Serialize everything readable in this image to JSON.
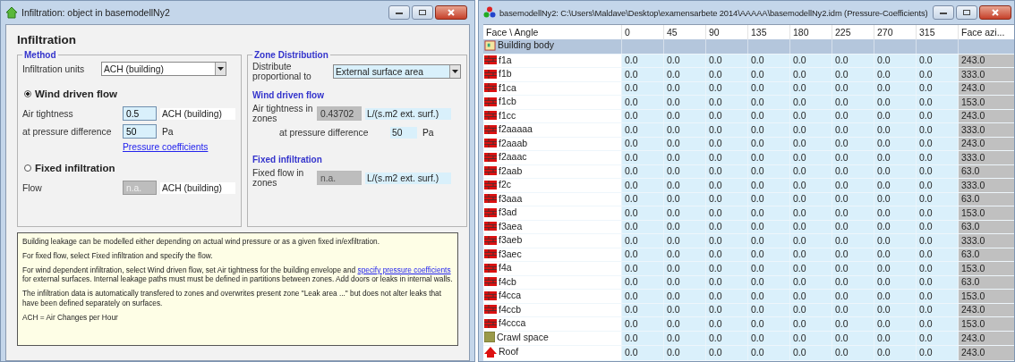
{
  "infiltration_window": {
    "title": "Infiltration: object in basemodellNy2",
    "heading": "Infiltration",
    "method": {
      "legend": "Method",
      "units_label": "Infiltration units",
      "units_value": "ACH (building)",
      "options": [
        {
          "label": "Wind driven flow",
          "selected": true
        },
        {
          "label": "Fixed infiltration",
          "selected": false
        }
      ],
      "air_tightness_label": "Air tightness",
      "air_tightness_value": "0.5",
      "air_tightness_unit": "ACH (building)",
      "pressure_label": "at pressure difference",
      "pressure_value": "50",
      "pressure_unit": "Pa",
      "pressure_link": "Pressure coefficients",
      "flow_label": "Flow",
      "flow_value": "n.a.",
      "flow_disabled": true,
      "flow_unit": "ACH (building)"
    },
    "zone_distribution": {
      "legend": "Zone Distribution",
      "distribute_label": "Distribute proportional to",
      "distribute_value": "External surface area",
      "wind_heading": "Wind driven flow",
      "zone_tightness_label": "Air tightness in zones",
      "zone_tightness_value": "0.43702",
      "zone_tightness_unit": "L/(s.m2 ext. surf.)",
      "zone_pressure_label": "at pressure difference",
      "zone_pressure_value": "50",
      "zone_pressure_unit": "Pa",
      "fixed_heading": "Fixed infiltration",
      "fixed_flow_label": "Fixed flow in zones",
      "fixed_flow_value": "n.a.",
      "fixed_flow_disabled": true,
      "fixed_flow_unit": "L/(s.m2 ext. surf.)"
    },
    "help": {
      "p1": "Building leakage can be modelled either depending on actual wind pressure or as a given fixed in/exfiltration.",
      "p2": "For fixed flow,  select Fixed infiltration and specify the flow.",
      "p3_before": "For wind dependent infiltration,  select Wind driven flow, set Air tightness for the building envelope and",
      "p3_link": "specify pressure coefficients",
      "p3_after": "for external surfaces. Internal leakage paths must must be defined in partitions between zones. Add doors or leaks in internal walls.",
      "p4": "The infiltration data is automatically  transfered  to zones and overwrites present zone \"Leak area ...\" but does not alter leaks that have been defined separately on surfaces.",
      "p5": "ACH = Air Changes per Hour"
    }
  },
  "coefficients_window": {
    "title": "basemodellNy2: C:\\Users\\Maldave\\Desktop\\examensarbete 2014\\AAAAA\\basemodellNy2.idm (Pressure-Coefficients)",
    "columns": [
      "Face \\ Angle",
      "0",
      "45",
      "90",
      "135",
      "180",
      "225",
      "270",
      "315",
      "Face azi..."
    ],
    "rows": [
      {
        "name": "Building body",
        "kind": "group"
      },
      {
        "name": "f1a",
        "kind": "wall",
        "values": [
          "0.0",
          "0.0",
          "0.0",
          "0.0",
          "0.0",
          "0.0",
          "0.0",
          "0.0"
        ],
        "azimuth": "243.0"
      },
      {
        "name": "f1b",
        "kind": "wall",
        "values": [
          "0.0",
          "0.0",
          "0.0",
          "0.0",
          "0.0",
          "0.0",
          "0.0",
          "0.0"
        ],
        "azimuth": "333.0"
      },
      {
        "name": "f1ca",
        "kind": "wall",
        "values": [
          "0.0",
          "0.0",
          "0.0",
          "0.0",
          "0.0",
          "0.0",
          "0.0",
          "0.0"
        ],
        "azimuth": "243.0"
      },
      {
        "name": "f1cb",
        "kind": "wall",
        "values": [
          "0.0",
          "0.0",
          "0.0",
          "0.0",
          "0.0",
          "0.0",
          "0.0",
          "0.0"
        ],
        "azimuth": "153.0"
      },
      {
        "name": "f1cc",
        "kind": "wall",
        "values": [
          "0.0",
          "0.0",
          "0.0",
          "0.0",
          "0.0",
          "0.0",
          "0.0",
          "0.0"
        ],
        "azimuth": "243.0"
      },
      {
        "name": "f2aaaaa",
        "kind": "wall",
        "values": [
          "0.0",
          "0.0",
          "0.0",
          "0.0",
          "0.0",
          "0.0",
          "0.0",
          "0.0"
        ],
        "azimuth": "333.0"
      },
      {
        "name": "f2aaab",
        "kind": "wall",
        "values": [
          "0.0",
          "0.0",
          "0.0",
          "0.0",
          "0.0",
          "0.0",
          "0.0",
          "0.0"
        ],
        "azimuth": "243.0"
      },
      {
        "name": "f2aaac",
        "kind": "wall",
        "values": [
          "0.0",
          "0.0",
          "0.0",
          "0.0",
          "0.0",
          "0.0",
          "0.0",
          "0.0"
        ],
        "azimuth": "333.0"
      },
      {
        "name": "f2aab",
        "kind": "wall",
        "values": [
          "0.0",
          "0.0",
          "0.0",
          "0.0",
          "0.0",
          "0.0",
          "0.0",
          "0.0"
        ],
        "azimuth": "63.0"
      },
      {
        "name": "f2c",
        "kind": "wall",
        "values": [
          "0.0",
          "0.0",
          "0.0",
          "0.0",
          "0.0",
          "0.0",
          "0.0",
          "0.0"
        ],
        "azimuth": "333.0"
      },
      {
        "name": "f3aaa",
        "kind": "wall",
        "values": [
          "0.0",
          "0.0",
          "0.0",
          "0.0",
          "0.0",
          "0.0",
          "0.0",
          "0.0"
        ],
        "azimuth": "63.0"
      },
      {
        "name": "f3ad",
        "kind": "wall",
        "values": [
          "0.0",
          "0.0",
          "0.0",
          "0.0",
          "0.0",
          "0.0",
          "0.0",
          "0.0"
        ],
        "azimuth": "153.0"
      },
      {
        "name": "f3aea",
        "kind": "wall",
        "values": [
          "0.0",
          "0.0",
          "0.0",
          "0.0",
          "0.0",
          "0.0",
          "0.0",
          "0.0"
        ],
        "azimuth": "63.0"
      },
      {
        "name": "f3aeb",
        "kind": "wall",
        "values": [
          "0.0",
          "0.0",
          "0.0",
          "0.0",
          "0.0",
          "0.0",
          "0.0",
          "0.0"
        ],
        "azimuth": "333.0"
      },
      {
        "name": "f3aec",
        "kind": "wall",
        "values": [
          "0.0",
          "0.0",
          "0.0",
          "0.0",
          "0.0",
          "0.0",
          "0.0",
          "0.0"
        ],
        "azimuth": "63.0"
      },
      {
        "name": "f4a",
        "kind": "wall",
        "values": [
          "0.0",
          "0.0",
          "0.0",
          "0.0",
          "0.0",
          "0.0",
          "0.0",
          "0.0"
        ],
        "azimuth": "153.0"
      },
      {
        "name": "f4cb",
        "kind": "wall",
        "values": [
          "0.0",
          "0.0",
          "0.0",
          "0.0",
          "0.0",
          "0.0",
          "0.0",
          "0.0"
        ],
        "azimuth": "63.0"
      },
      {
        "name": "f4cca",
        "kind": "wall",
        "values": [
          "0.0",
          "0.0",
          "0.0",
          "0.0",
          "0.0",
          "0.0",
          "0.0",
          "0.0"
        ],
        "azimuth": "153.0"
      },
      {
        "name": "f4ccb",
        "kind": "wall",
        "values": [
          "0.0",
          "0.0",
          "0.0",
          "0.0",
          "0.0",
          "0.0",
          "0.0",
          "0.0"
        ],
        "azimuth": "243.0"
      },
      {
        "name": "f4ccca",
        "kind": "wall",
        "values": [
          "0.0",
          "0.0",
          "0.0",
          "0.0",
          "0.0",
          "0.0",
          "0.0",
          "0.0"
        ],
        "azimuth": "153.0"
      },
      {
        "name": "Crawl space",
        "kind": "floor",
        "values": [
          "0.0",
          "0.0",
          "0.0",
          "0.0",
          "0.0",
          "0.0",
          "0.0",
          "0.0"
        ],
        "azimuth": "243.0"
      },
      {
        "name": "Roof",
        "kind": "roof",
        "values": [
          "0.0",
          "0.0",
          "0.0",
          "0.0",
          "0.0",
          "0.0",
          "0.0",
          "0.0"
        ],
        "azimuth": "243.0"
      }
    ]
  }
}
